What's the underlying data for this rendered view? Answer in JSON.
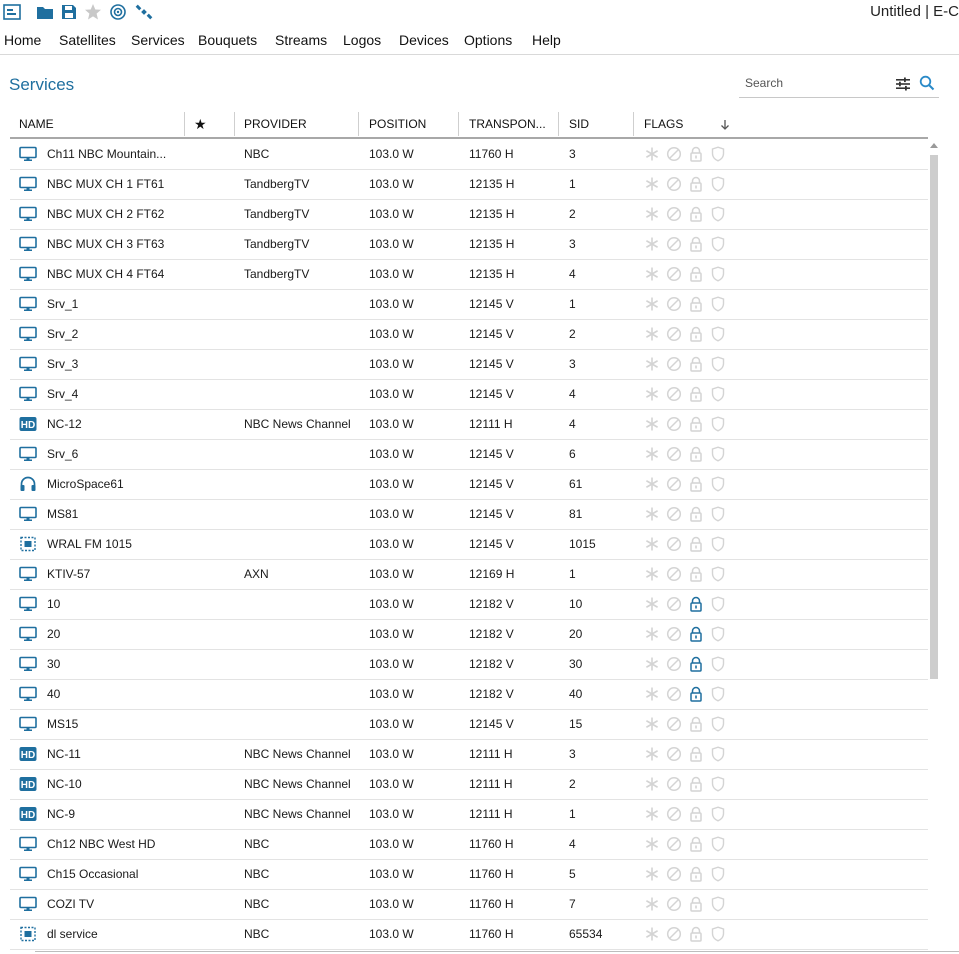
{
  "window": {
    "title": "Untitled | E-C"
  },
  "toolbar": {
    "icons": [
      "app-logo-icon",
      "open-folder-icon",
      "save-icon",
      "favorite-star-icon",
      "satellite-dish-icon",
      "satellite-icon"
    ],
    "accent": "#1f6f9f"
  },
  "menu": [
    "Home",
    "Satellites",
    "Services",
    "Bouquets",
    "Streams",
    "Logos",
    "Devices",
    "Options",
    "Help"
  ],
  "page": {
    "title": "Services"
  },
  "search": {
    "placeholder": "Search",
    "value": ""
  },
  "table": {
    "columns": {
      "name": "NAME",
      "fav": "★",
      "provider": "PROVIDER",
      "position": "POSITION",
      "transponder": "TRANSPON...",
      "sid": "SID",
      "flags": "FLAGS"
    },
    "sort_indicator": "sort-down-arrow-icon",
    "flag_icons": [
      "asterisk-flag-icon",
      "blocked-flag-icon",
      "lock-flag-icon",
      "shield-flag-icon"
    ],
    "rows": [
      {
        "type": "tv",
        "name": "Ch11 NBC Mountain...",
        "provider": "NBC",
        "position": "103.0 W",
        "transponder": "11760 H",
        "sid": "3",
        "locked": false
      },
      {
        "type": "tv",
        "name": "NBC MUX CH 1 FT61",
        "provider": "TandbergTV",
        "position": "103.0 W",
        "transponder": "12135 H",
        "sid": "1",
        "locked": false
      },
      {
        "type": "tv",
        "name": "NBC MUX CH 2 FT62",
        "provider": "TandbergTV",
        "position": "103.0 W",
        "transponder": "12135 H",
        "sid": "2",
        "locked": false
      },
      {
        "type": "tv",
        "name": "NBC MUX CH 3 FT63",
        "provider": "TandbergTV",
        "position": "103.0 W",
        "transponder": "12135 H",
        "sid": "3",
        "locked": false
      },
      {
        "type": "tv",
        "name": "NBC MUX CH 4 FT64",
        "provider": "TandbergTV",
        "position": "103.0 W",
        "transponder": "12135 H",
        "sid": "4",
        "locked": false
      },
      {
        "type": "tv",
        "name": "Srv_1",
        "provider": "",
        "position": "103.0 W",
        "transponder": "12145 V",
        "sid": "1",
        "locked": false
      },
      {
        "type": "tv",
        "name": "Srv_2",
        "provider": "",
        "position": "103.0 W",
        "transponder": "12145 V",
        "sid": "2",
        "locked": false
      },
      {
        "type": "tv",
        "name": "Srv_3",
        "provider": "",
        "position": "103.0 W",
        "transponder": "12145 V",
        "sid": "3",
        "locked": false
      },
      {
        "type": "tv",
        "name": "Srv_4",
        "provider": "",
        "position": "103.0 W",
        "transponder": "12145 V",
        "sid": "4",
        "locked": false
      },
      {
        "type": "hd",
        "name": "NC-12",
        "provider": "NBC News Channel",
        "position": "103.0 W",
        "transponder": "12111 H",
        "sid": "4",
        "locked": false
      },
      {
        "type": "tv",
        "name": "Srv_6",
        "provider": "",
        "position": "103.0 W",
        "transponder": "12145 V",
        "sid": "6",
        "locked": false
      },
      {
        "type": "radio",
        "name": "MicroSpace61",
        "provider": "",
        "position": "103.0 W",
        "transponder": "12145 V",
        "sid": "61",
        "locked": false
      },
      {
        "type": "tv",
        "name": "MS81",
        "provider": "",
        "position": "103.0 W",
        "transponder": "12145 V",
        "sid": "81",
        "locked": false
      },
      {
        "type": "data",
        "name": "WRAL FM 1015",
        "provider": "",
        "position": "103.0 W",
        "transponder": "12145 V",
        "sid": "1015",
        "locked": false
      },
      {
        "type": "tv",
        "name": "KTIV-57",
        "provider": "AXN",
        "position": "103.0 W",
        "transponder": "12169 H",
        "sid": "1",
        "locked": false
      },
      {
        "type": "tv",
        "name": "10",
        "provider": "",
        "position": "103.0 W",
        "transponder": "12182 V",
        "sid": "10",
        "locked": true
      },
      {
        "type": "tv",
        "name": "20",
        "provider": "",
        "position": "103.0 W",
        "transponder": "12182 V",
        "sid": "20",
        "locked": true
      },
      {
        "type": "tv",
        "name": "30",
        "provider": "",
        "position": "103.0 W",
        "transponder": "12182 V",
        "sid": "30",
        "locked": true
      },
      {
        "type": "tv",
        "name": "40",
        "provider": "",
        "position": "103.0 W",
        "transponder": "12182 V",
        "sid": "40",
        "locked": true
      },
      {
        "type": "tv",
        "name": "MS15",
        "provider": "",
        "position": "103.0 W",
        "transponder": "12145 V",
        "sid": "15",
        "locked": false
      },
      {
        "type": "hd",
        "name": "NC-11",
        "provider": "NBC News Channel",
        "position": "103.0 W",
        "transponder": "12111 H",
        "sid": "3",
        "locked": false
      },
      {
        "type": "hd",
        "name": "NC-10",
        "provider": "NBC News Channel",
        "position": "103.0 W",
        "transponder": "12111 H",
        "sid": "2",
        "locked": false
      },
      {
        "type": "hd",
        "name": "NC-9",
        "provider": "NBC News Channel",
        "position": "103.0 W",
        "transponder": "12111 H",
        "sid": "1",
        "locked": false
      },
      {
        "type": "tv",
        "name": "Ch12 NBC West HD",
        "provider": "NBC",
        "position": "103.0 W",
        "transponder": "11760 H",
        "sid": "4",
        "locked": false
      },
      {
        "type": "tv",
        "name": "Ch15 Occasional",
        "provider": "NBC",
        "position": "103.0 W",
        "transponder": "11760 H",
        "sid": "5",
        "locked": false
      },
      {
        "type": "tv",
        "name": "COZI TV",
        "provider": "NBC",
        "position": "103.0 W",
        "transponder": "11760 H",
        "sid": "7",
        "locked": false
      },
      {
        "type": "data",
        "name": "dl service",
        "provider": "NBC",
        "position": "103.0 W",
        "transponder": "11760 H",
        "sid": "65534",
        "locked": false
      }
    ]
  },
  "colors": {
    "icon_blue": "#1f6f9f",
    "flag_inactive": "#d4d4d4",
    "lock_active": "#1f6f9f"
  }
}
